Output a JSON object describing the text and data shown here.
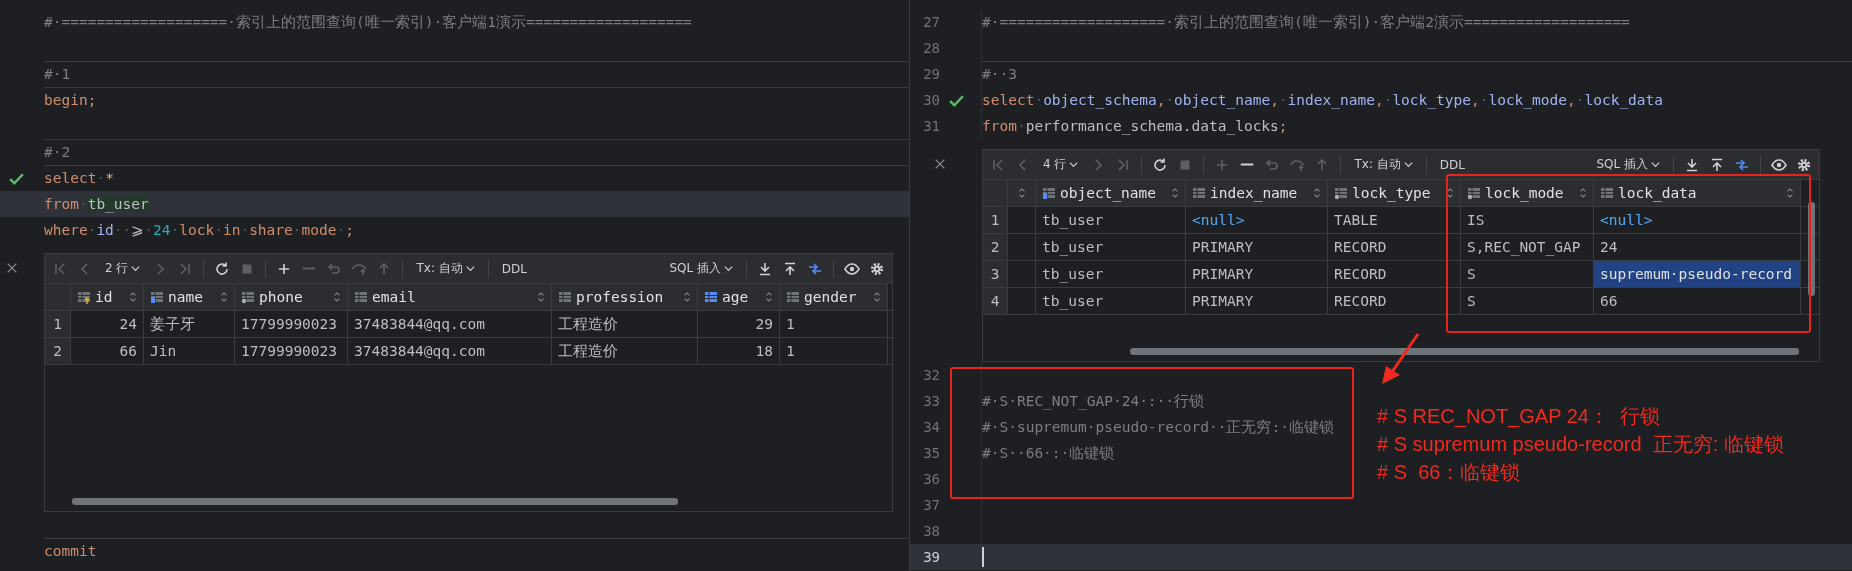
{
  "editors": [
    {
      "lines_before": [
        {
          "kind": "code",
          "divider_above": false,
          "current": false,
          "tokens": [
            {
              "t": "#·===================·索引上的范围查询(唯一索引)·客户端1演示===================",
              "kind": "comment"
            }
          ]
        },
        {
          "kind": "blank",
          "divider_above": false,
          "current": false
        },
        {
          "kind": "code",
          "divider_above": true,
          "current": false,
          "tokens": [
            {
              "t": "#·1",
              "kind": "comment"
            }
          ]
        },
        {
          "kind": "code",
          "divider_above": true,
          "current": false,
          "tokens": [
            {
              "t": "begin;",
              "kind": "keyword"
            }
          ]
        },
        {
          "kind": "blank",
          "divider_above": false,
          "current": false
        },
        {
          "kind": "code",
          "divider_above": true,
          "current": false,
          "tokens": [
            {
              "t": "#·2",
              "kind": "comment"
            }
          ]
        },
        {
          "kind": "executed",
          "divider_above": true,
          "current": false,
          "tokens": [
            {
              "t": "select",
              "kind": "keyword"
            },
            {
              "t": "·",
              "kind": "space"
            },
            {
              "t": "*",
              "kind": "wildcard"
            }
          ]
        },
        {
          "kind": "code",
          "divider_above": false,
          "current": true,
          "tokens": [
            {
              "t": "from",
              "kind": "keyword"
            },
            {
              "t": "·",
              "kind": "space"
            },
            {
              "t": "tb_user",
              "kind": "table"
            }
          ]
        },
        {
          "kind": "code",
          "divider_above": false,
          "current": false,
          "tokens": [
            {
              "t": "where",
              "kind": "keyword"
            },
            {
              "t": "·",
              "kind": "space"
            },
            {
              "t": "id",
              "kind": "column"
            },
            {
              "t": "··",
              "kind": "space"
            },
            {
              "t": "⩾",
              "kind": "plain"
            },
            {
              "t": "·",
              "kind": "space"
            },
            {
              "t": "24",
              "kind": "number"
            },
            {
              "t": "·",
              "kind": "space"
            },
            {
              "t": "lock",
              "kind": "keyword"
            },
            {
              "t": "·",
              "kind": "space"
            },
            {
              "t": "in",
              "kind": "keyword"
            },
            {
              "t": "·",
              "kind": "space"
            },
            {
              "t": "share",
              "kind": "keyword"
            },
            {
              "t": "·",
              "kind": "space"
            },
            {
              "t": "mode",
              "kind": "keyword"
            },
            {
              "t": "·",
              "kind": "space"
            },
            {
              "t": ";",
              "kind": "keyword"
            }
          ]
        }
      ],
      "grid": {
        "toolbar_left": [
          {
            "kind": "button",
            "disabled": true
          },
          {
            "kind": "button",
            "disabled": true
          },
          {
            "kind": "dropdown",
            "text": "2 行"
          },
          {
            "kind": "button",
            "disabled": true
          },
          {
            "kind": "button",
            "disabled": true
          },
          {
            "kind": "separator"
          },
          {
            "kind": "button",
            "disabled": false
          },
          {
            "kind": "button",
            "disabled": true
          },
          {
            "kind": "separator"
          },
          {
            "kind": "button",
            "disabled": false
          },
          {
            "kind": "button",
            "disabled": true
          },
          {
            "kind": "button",
            "disabled": true
          },
          {
            "kind": "button",
            "disabled": true
          },
          {
            "kind": "button",
            "disabled": true
          },
          {
            "kind": "separator"
          },
          {
            "kind": "dropdown",
            "text": "Tx: 自动"
          },
          {
            "kind": "separator"
          },
          {
            "kind": "text",
            "text": "DDL"
          }
        ],
        "toolbar_right": [
          {
            "kind": "dropdown",
            "text": "SQL 插入"
          },
          {
            "kind": "separator"
          },
          {
            "kind": "button",
            "disabled": false
          },
          {
            "kind": "button",
            "disabled": false
          },
          {
            "kind": "button",
            "disabled": false
          },
          {
            "kind": "separator"
          },
          {
            "kind": "button",
            "disabled": false
          },
          {
            "kind": "button",
            "disabled": false
          }
        ],
        "columns": [
          {
            "name": "id",
            "kind": "key",
            "numeric": true
          },
          {
            "name": "name",
            "kind": "indexed",
            "numeric": false
          },
          {
            "name": "phone",
            "kind": "marked",
            "numeric": false
          },
          {
            "name": "email",
            "kind": "plain",
            "numeric": false
          },
          {
            "name": "profession",
            "kind": "plain",
            "numeric": false
          },
          {
            "name": "age",
            "kind": "filled",
            "numeric": true
          },
          {
            "name": "gender",
            "kind": "plain",
            "numeric": false
          }
        ],
        "rows": [
          {
            "number": "1",
            "cells": [
              {
                "text": "24",
                "kind": "value",
                "selected": false
              },
              {
                "text": "姜子牙",
                "kind": "value",
                "selected": false
              },
              {
                "text": "17799990023",
                "kind": "value",
                "selected": false
              },
              {
                "text": "37483844@qq.com",
                "kind": "value",
                "selected": false
              },
              {
                "text": "工程造价",
                "kind": "value",
                "selected": false
              },
              {
                "text": "29",
                "kind": "value",
                "selected": false
              },
              {
                "text": "1",
                "kind": "value",
                "selected": false
              }
            ]
          },
          {
            "number": "2",
            "cells": [
              {
                "text": "66",
                "kind": "value",
                "selected": false
              },
              {
                "text": "Jin",
                "kind": "value",
                "selected": false
              },
              {
                "text": "17799990023",
                "kind": "value",
                "selected": false
              },
              {
                "text": "37483844@qq.com",
                "kind": "value",
                "selected": false
              },
              {
                "text": "工程造价",
                "kind": "value",
                "selected": false
              },
              {
                "text": "18",
                "kind": "value",
                "selected": false
              },
              {
                "text": "1",
                "kind": "value",
                "selected": false
              }
            ]
          }
        ]
      },
      "lines_after": [
        {
          "kind": "blank",
          "divider_above": false,
          "current": false
        },
        {
          "kind": "code",
          "divider_above": true,
          "current": false,
          "tokens": [
            {
              "t": "commit",
              "kind": "keyword"
            }
          ]
        }
      ]
    },
    {
      "caret": true,
      "lines_before": [
        {
          "number": "27",
          "kind": "code",
          "divider_above": false,
          "current": false,
          "tokens": [
            {
              "t": "#·===================·索引上的范围查询(唯一索引)·客户端2演示===================",
              "kind": "comment"
            }
          ]
        },
        {
          "number": "28",
          "kind": "blank",
          "divider_above": false,
          "current": false
        },
        {
          "number": "29",
          "kind": "code",
          "divider_above": true,
          "current": false,
          "tokens": [
            {
              "t": "#··3",
              "kind": "comment"
            }
          ]
        },
        {
          "number": "30",
          "kind": "executed",
          "divider_above": false,
          "current": false,
          "tokens": [
            {
              "t": "select",
              "kind": "keyword"
            },
            {
              "t": "·",
              "kind": "space"
            },
            {
              "t": "object_schema",
              "kind": "column"
            },
            {
              "t": ",",
              "kind": "keyword"
            },
            {
              "t": "·",
              "kind": "space"
            },
            {
              "t": "object_name",
              "kind": "column"
            },
            {
              "t": ",",
              "kind": "keyword"
            },
            {
              "t": "·",
              "kind": "space"
            },
            {
              "t": "index_name",
              "kind": "column"
            },
            {
              "t": ",",
              "kind": "keyword"
            },
            {
              "t": "·",
              "kind": "space"
            },
            {
              "t": "lock_type",
              "kind": "column"
            },
            {
              "t": ",",
              "kind": "keyword"
            },
            {
              "t": "·",
              "kind": "space"
            },
            {
              "t": "lock_mode",
              "kind": "column"
            },
            {
              "t": ",",
              "kind": "keyword"
            },
            {
              "t": "·",
              "kind": "space"
            },
            {
              "t": "lock_data",
              "kind": "column"
            }
          ]
        },
        {
          "number": "31",
          "kind": "code",
          "divider_above": false,
          "current": false,
          "tokens": [
            {
              "t": "from",
              "kind": "keyword"
            },
            {
              "t": "·",
              "kind": "space"
            },
            {
              "t": "performance_schema.data_locks",
              "kind": "plain"
            },
            {
              "t": ";",
              "kind": "keyword"
            }
          ]
        }
      ],
      "grid": {
        "collapsed_first_column": true,
        "toolbar_left": [
          {
            "kind": "button",
            "disabled": true
          },
          {
            "kind": "button",
            "disabled": true
          },
          {
            "kind": "dropdown",
            "text": "4 行"
          },
          {
            "kind": "button",
            "disabled": true
          },
          {
            "kind": "button",
            "disabled": true
          },
          {
            "kind": "separator"
          },
          {
            "kind": "button",
            "disabled": false
          },
          {
            "kind": "button",
            "disabled": true
          },
          {
            "kind": "separator"
          },
          {
            "kind": "button",
            "disabled": true
          },
          {
            "kind": "button",
            "disabled": false
          },
          {
            "kind": "button",
            "disabled": true
          },
          {
            "kind": "button",
            "disabled": true
          },
          {
            "kind": "button",
            "disabled": true
          },
          {
            "kind": "separator"
          },
          {
            "kind": "dropdown",
            "text": "Tx: 自动"
          },
          {
            "kind": "separator"
          },
          {
            "kind": "text",
            "text": "DDL"
          }
        ],
        "toolbar_right": [
          {
            "kind": "dropdown",
            "text": "SQL 插入"
          },
          {
            "kind": "separator"
          },
          {
            "kind": "button",
            "disabled": false
          },
          {
            "kind": "button",
            "disabled": false
          },
          {
            "kind": "button",
            "disabled": false
          },
          {
            "kind": "separator"
          },
          {
            "kind": "button",
            "disabled": false
          },
          {
            "kind": "button",
            "disabled": false
          }
        ],
        "columns": [
          {
            "name": "object_name",
            "kind": "indexed",
            "numeric": false
          },
          {
            "name": "index_name",
            "kind": "plain",
            "numeric": false
          },
          {
            "name": "lock_type",
            "kind": "marked",
            "numeric": false
          },
          {
            "name": "lock_mode",
            "kind": "marked",
            "numeric": false
          },
          {
            "name": "lock_data",
            "kind": "plain",
            "numeric": false
          }
        ],
        "rows": [
          {
            "number": "1",
            "cells": [
              {
                "text": "tb_user",
                "kind": "value",
                "selected": false
              },
              {
                "text": "<null>",
                "kind": "null",
                "selected": false
              },
              {
                "text": "TABLE",
                "kind": "value",
                "selected": false
              },
              {
                "text": "IS",
                "kind": "value",
                "selected": false
              },
              {
                "text": "<null>",
                "kind": "null",
                "selected": false
              }
            ]
          },
          {
            "number": "2",
            "cells": [
              {
                "text": "tb_user",
                "kind": "value",
                "selected": false
              },
              {
                "text": "PRIMARY",
                "kind": "value",
                "selected": false
              },
              {
                "text": "RECORD",
                "kind": "value",
                "selected": false
              },
              {
                "text": "S,REC_NOT_GAP",
                "kind": "value",
                "selected": false
              },
              {
                "text": "24",
                "kind": "value",
                "selected": false
              }
            ]
          },
          {
            "number": "3",
            "cells": [
              {
                "text": "tb_user",
                "kind": "value",
                "selected": false
              },
              {
                "text": "PRIMARY",
                "kind": "value",
                "selected": false
              },
              {
                "text": "RECORD",
                "kind": "value",
                "selected": false
              },
              {
                "text": "S",
                "kind": "value",
                "selected": false
              },
              {
                "text": "supremum·pseudo-record",
                "kind": "value",
                "selected": true
              }
            ]
          },
          {
            "number": "4",
            "cells": [
              {
                "text": "tb_user",
                "kind": "value",
                "selected": false
              },
              {
                "text": "PRIMARY",
                "kind": "value",
                "selected": false
              },
              {
                "text": "RECORD",
                "kind": "value",
                "selected": false
              },
              {
                "text": "S",
                "kind": "value",
                "selected": false
              },
              {
                "text": "66",
                "kind": "value",
                "selected": false
              }
            ]
          }
        ]
      },
      "lines_after": [
        {
          "number": "32",
          "kind": "blank",
          "divider_above": false,
          "current": false
        },
        {
          "number": "33",
          "kind": "code",
          "divider_above": false,
          "current": false,
          "tokens": [
            {
              "t": "#·S·REC_NOT_GAP·24·:··行锁",
              "kind": "comment"
            }
          ]
        },
        {
          "number": "34",
          "kind": "code",
          "divider_above": false,
          "current": false,
          "tokens": [
            {
              "t": "#·S·supremum·pseudo-record··正无穷:·临键锁",
              "kind": "comment"
            }
          ]
        },
        {
          "number": "35",
          "kind": "code",
          "divider_above": false,
          "current": false,
          "tokens": [
            {
              "t": "#·S··66·:·临键锁",
              "kind": "comment"
            }
          ]
        },
        {
          "number": "36",
          "kind": "blank",
          "divider_above": false,
          "current": false
        },
        {
          "number": "37",
          "kind": "blank",
          "divider_above": false,
          "current": false
        },
        {
          "number": "38",
          "kind": "blank",
          "divider_above": false,
          "current": false
        },
        {
          "number": "39",
          "kind": "blank",
          "divider_above": false,
          "current": true
        }
      ]
    }
  ],
  "annotation": {
    "lines": [
      "# S REC_NOT_GAP 24：  行锁",
      "# S supremum pseudo-record  正无穷: 临键锁",
      "# S  66：临键锁"
    ]
  }
}
